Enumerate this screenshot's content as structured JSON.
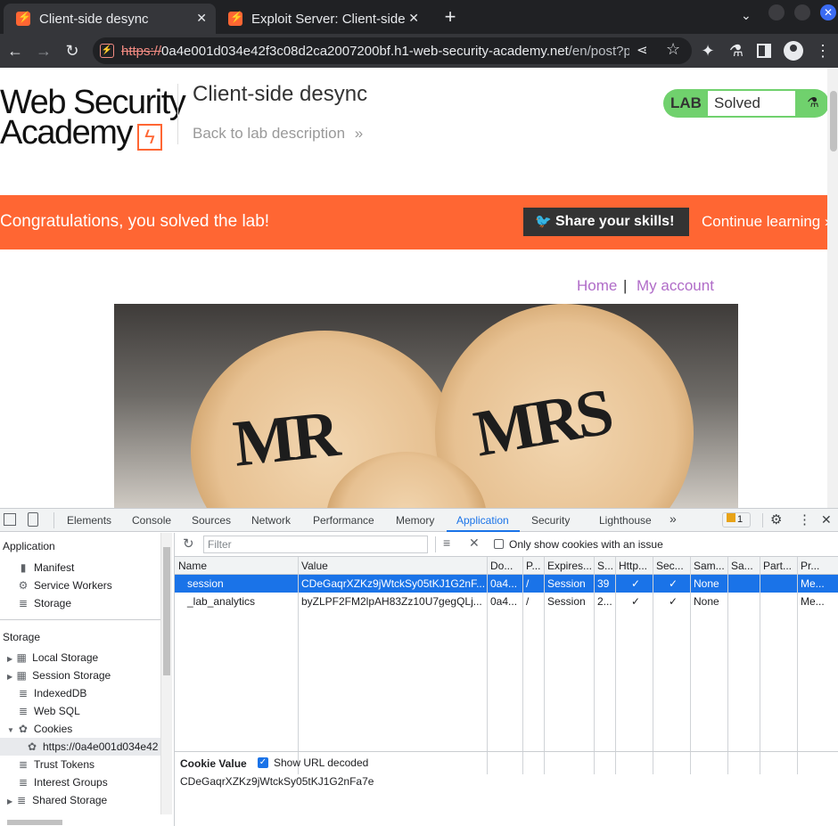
{
  "browser": {
    "tabs": [
      {
        "title": "Client-side desync",
        "active": true
      },
      {
        "title": "Exploit Server: Client-side desync",
        "active": false
      }
    ],
    "new_tab_glyph": "+",
    "url": {
      "scheme": "https://",
      "host": "0a4e001d034e42f3c08d2ca2007200bf.h1-web-security-academy.net",
      "path": "/en/post?p..."
    }
  },
  "page": {
    "logo_line1": "Web Security",
    "logo_line2": "Academy",
    "lab_title": "Client-side desync",
    "back_link": "Back to lab description",
    "lab_badge": {
      "label": "LAB",
      "status": "Solved"
    },
    "banner": {
      "message": "Congratulations, you solved the lab!",
      "share": "Share your skills!",
      "continue": "Continue learning"
    },
    "nav": {
      "home": "Home",
      "separator": "|",
      "account": "My account"
    },
    "hero_text": {
      "left": "MR",
      "right": "MRS"
    },
    "colors": {
      "accent": "#ff6633",
      "lab_green": "#70d16d",
      "link_purple": "#b06cc8"
    }
  },
  "devtools": {
    "tabs": [
      "Elements",
      "Console",
      "Sources",
      "Network",
      "Performance",
      "Memory",
      "Application",
      "Security",
      "Lighthouse"
    ],
    "active_tab": "Application",
    "issues_count": "1",
    "sidebar": {
      "application_header": "Application",
      "application_items": [
        "Manifest",
        "Service Workers",
        "Storage"
      ],
      "storage_header": "Storage",
      "storage_items": [
        "Local Storage",
        "Session Storage",
        "IndexedDB",
        "Web SQL",
        "Cookies"
      ],
      "cookie_origin": "https://0a4e001d034e42",
      "other_items": [
        "Trust Tokens",
        "Interest Groups",
        "Shared Storage"
      ]
    },
    "filter": {
      "placeholder": "Filter",
      "only_issues_label": "Only show cookies with an issue"
    },
    "columns": [
      "Name",
      "Value",
      "Do...",
      "P...",
      "Expires...",
      "S...",
      "Http...",
      "Sec...",
      "Sam...",
      "Sa...",
      "Part...",
      "Pr..."
    ],
    "rows": [
      {
        "name": "session",
        "value": "CDeGaqrXZKz9jWtckSy05tKJ1G2nF...",
        "domain": "0a4...",
        "path": "/",
        "expires": "Session",
        "size": "39",
        "http": "✓",
        "secure": "✓",
        "samesite": "None",
        "sameparty": "",
        "partition": "",
        "priority": "Me..."
      },
      {
        "name": "_lab_analytics",
        "value": "byZLPF2FM2lpAH83Zz10U7gegQLj...",
        "domain": "0a4...",
        "path": "/",
        "expires": "Session",
        "size": "2...",
        "http": "✓",
        "secure": "✓",
        "samesite": "None",
        "sameparty": "",
        "partition": "",
        "priority": "Me..."
      }
    ],
    "cookie_value": {
      "label": "Cookie Value",
      "decode_label": "Show URL decoded",
      "value": "CDeGaqrXZKz9jWtckSy05tKJ1G2nFa7e"
    }
  }
}
